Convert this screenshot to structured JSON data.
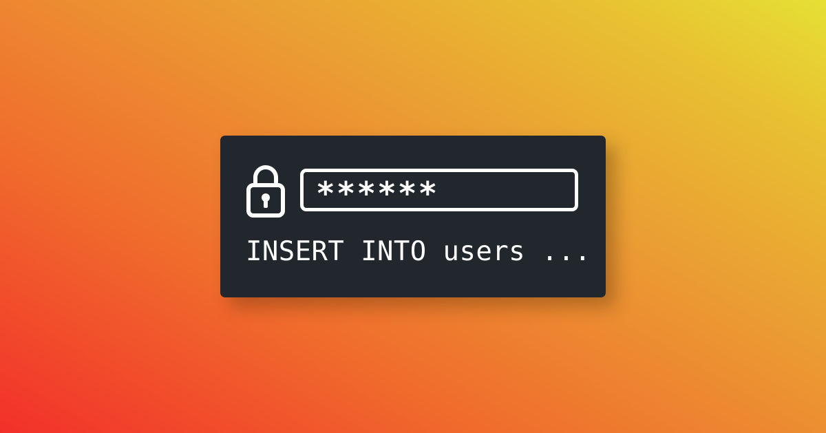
{
  "password_field": {
    "value": "******"
  },
  "query_text": "INSERT INTO users ...",
  "icons": {
    "lock": "lock-icon"
  },
  "colors": {
    "card_background": "#22272e",
    "foreground": "#ffffff",
    "gradient_start": "#f2302a",
    "gradient_end": "#e6e034"
  }
}
